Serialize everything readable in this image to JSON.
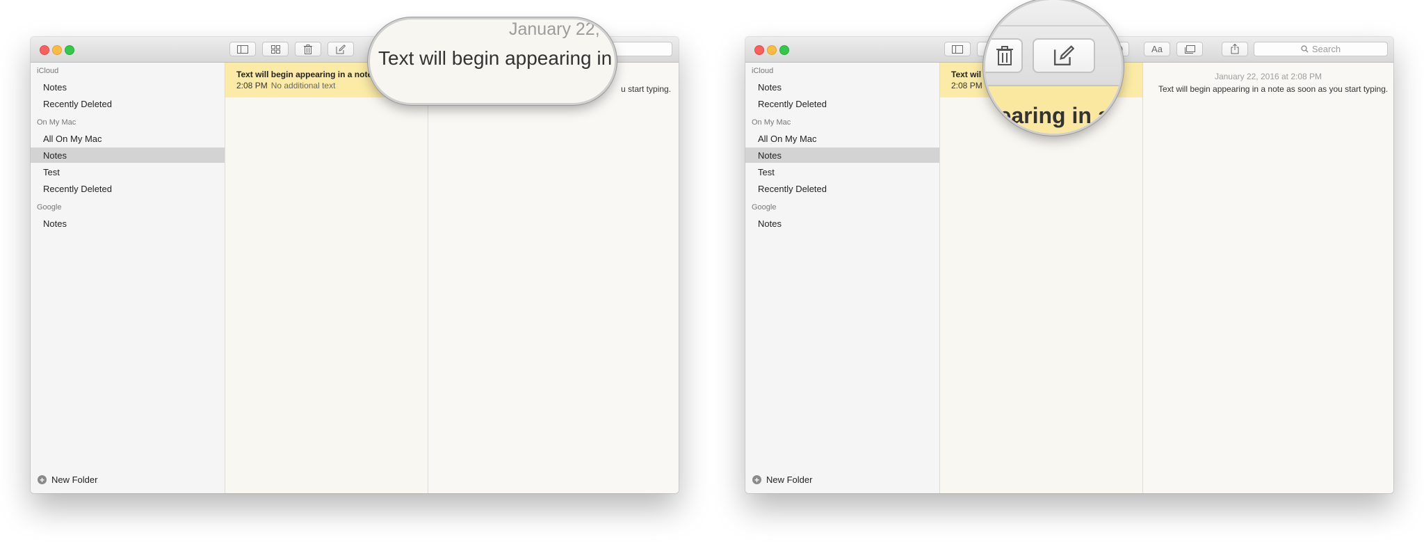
{
  "toolbar": {
    "search_placeholder": "Search",
    "format_label": "Aa"
  },
  "sidebar": {
    "groups": [
      {
        "name": "iCloud",
        "items": [
          "Notes",
          "Recently Deleted"
        ]
      },
      {
        "name": "On My Mac",
        "items": [
          "All On My Mac",
          "Notes",
          "Test",
          "Recently Deleted"
        ]
      },
      {
        "name": "Google",
        "items": [
          "Notes"
        ]
      }
    ],
    "selected": "On My Mac / Notes",
    "new_folder_label": "New Folder"
  },
  "note_list": {
    "title": "Text will begin appearing in a note as soon as you start typing.",
    "title_truncated_right": "Text wil",
    "time": "2:08 PM",
    "time_right": "2:08 PM",
    "preview": "No additional text"
  },
  "editor": {
    "date": "January 22, 2016 at 2:08 PM",
    "body": "Text will begin appearing in a note as soon as you start typing.",
    "body_tail_left": "u start typing."
  },
  "magnifier_left": {
    "date_fragment": "January 22,",
    "text_fragment": "Text will begin appearing in a n"
  },
  "magnifier_right": {
    "text_fragment": "pearing in a"
  },
  "colors": {
    "selected_note": "#fbeba7",
    "selected_sidebar": "#d3d3d3",
    "close": "#fc605c",
    "minimize": "#fdbc40",
    "zoom": "#34c84a"
  }
}
